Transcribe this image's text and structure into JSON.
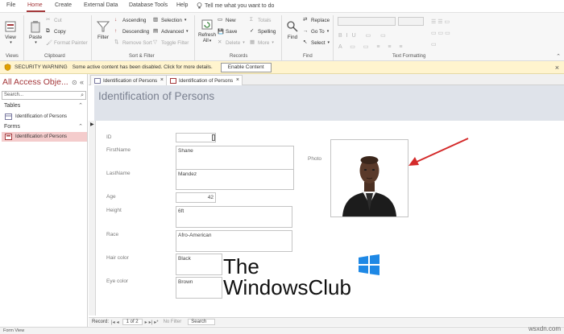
{
  "ribbon_tabs": [
    "File",
    "Home",
    "Create",
    "External Data",
    "Database Tools",
    "Help"
  ],
  "tell_me": "Tell me what you want to do",
  "ribbon": {
    "views": {
      "view_label": "View",
      "group": "Views"
    },
    "clipboard": {
      "paste": "Paste",
      "cut": "Cut",
      "copy": "Copy",
      "format_painter": "Format Painter",
      "group": "Clipboard"
    },
    "sort_filter": {
      "filter": "Filter",
      "ascending": "Ascending",
      "descending": "Descending",
      "remove_sort": "Remove Sort",
      "selection": "Selection",
      "advanced": "Advanced",
      "toggle_filter": "Toggle Filter",
      "group": "Sort & Filter"
    },
    "records": {
      "refresh": "Refresh",
      "refresh_all": "All",
      "new": "New",
      "save": "Save",
      "delete": "Delete",
      "totals": "Totals",
      "spelling": "Spelling",
      "more": "More",
      "group": "Records"
    },
    "find": {
      "find": "Find",
      "replace": "Replace",
      "goto": "Go To",
      "select": "Select",
      "group": "Find"
    },
    "text_formatting": {
      "group": "Text Formatting"
    }
  },
  "security_bar": {
    "title": "SECURITY WARNING",
    "message": "Some active content has been disabled. Click for more details.",
    "button": "Enable Content"
  },
  "nav": {
    "title": "All Access Obje...",
    "search_placeholder": "Search...",
    "sections": [
      {
        "name": "Tables",
        "items": [
          "Identification of Persons"
        ]
      },
      {
        "name": "Forms",
        "items": [
          "Identification of Persons"
        ]
      }
    ]
  },
  "doc_tabs": [
    "Identification of Persons",
    "Identification of Persons"
  ],
  "form": {
    "title": "Identification of Persons",
    "fields": {
      "id": {
        "label": "ID",
        "value": ""
      },
      "firstname": {
        "label": "FirstName",
        "value": "Shane"
      },
      "lastname": {
        "label": "LastName",
        "value": "Mandez"
      },
      "age": {
        "label": "Age",
        "value": "42"
      },
      "height": {
        "label": "Height",
        "value": "6ft"
      },
      "race": {
        "label": "Race",
        "value": "Afro-American"
      },
      "hair": {
        "label": "Hair color",
        "value": "Black"
      },
      "eye": {
        "label": "Eye color",
        "value": "Brown"
      }
    },
    "photo_label": "Photo"
  },
  "record_nav": {
    "label": "Record:",
    "position": "1 of 2",
    "filter": "No Filter",
    "search": "Search"
  },
  "status": "Form View",
  "watermark": {
    "line1": "The",
    "line2": "WindowsClub",
    "site": "wsxdn.com"
  },
  "colors": {
    "accent": "#a4373a",
    "warning_bg": "#fff4ce",
    "form_header": "#dfe3ea",
    "arrow": "#d42a2a"
  }
}
